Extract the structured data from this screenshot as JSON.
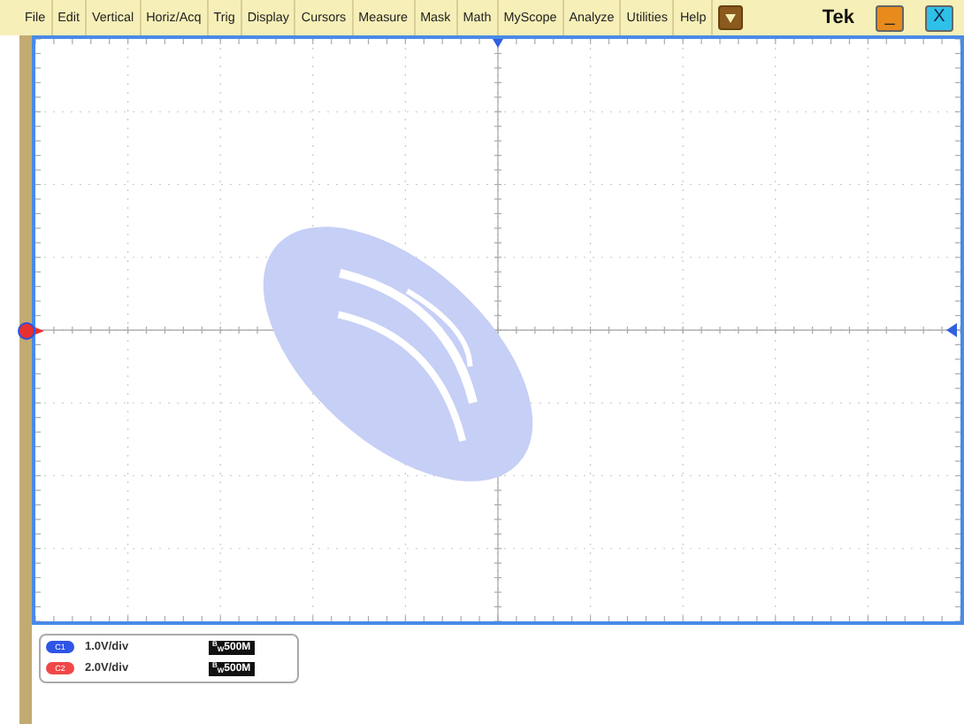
{
  "menu_bar": {
    "items": [
      "File",
      "Edit",
      "Vertical",
      "Horiz/Acq",
      "Trig",
      "Display",
      "Cursors",
      "Measure",
      "Mask",
      "Math",
      "MyScope",
      "Analyze",
      "Utilities",
      "Help"
    ],
    "brand": "Tek",
    "minimize_button": "_",
    "close_button": "X"
  },
  "channels": [
    {
      "label": "C1",
      "color": "#2f55e6",
      "scale": "1.0V/div",
      "bandwidth": "$^{B}$$_{W}$500M"
    },
    {
      "label": "C2",
      "color": "#f04848",
      "scale": "2.0V/div",
      "bandwidth": "$^{B}$$_{W}$500M"
    }
  ]
}
